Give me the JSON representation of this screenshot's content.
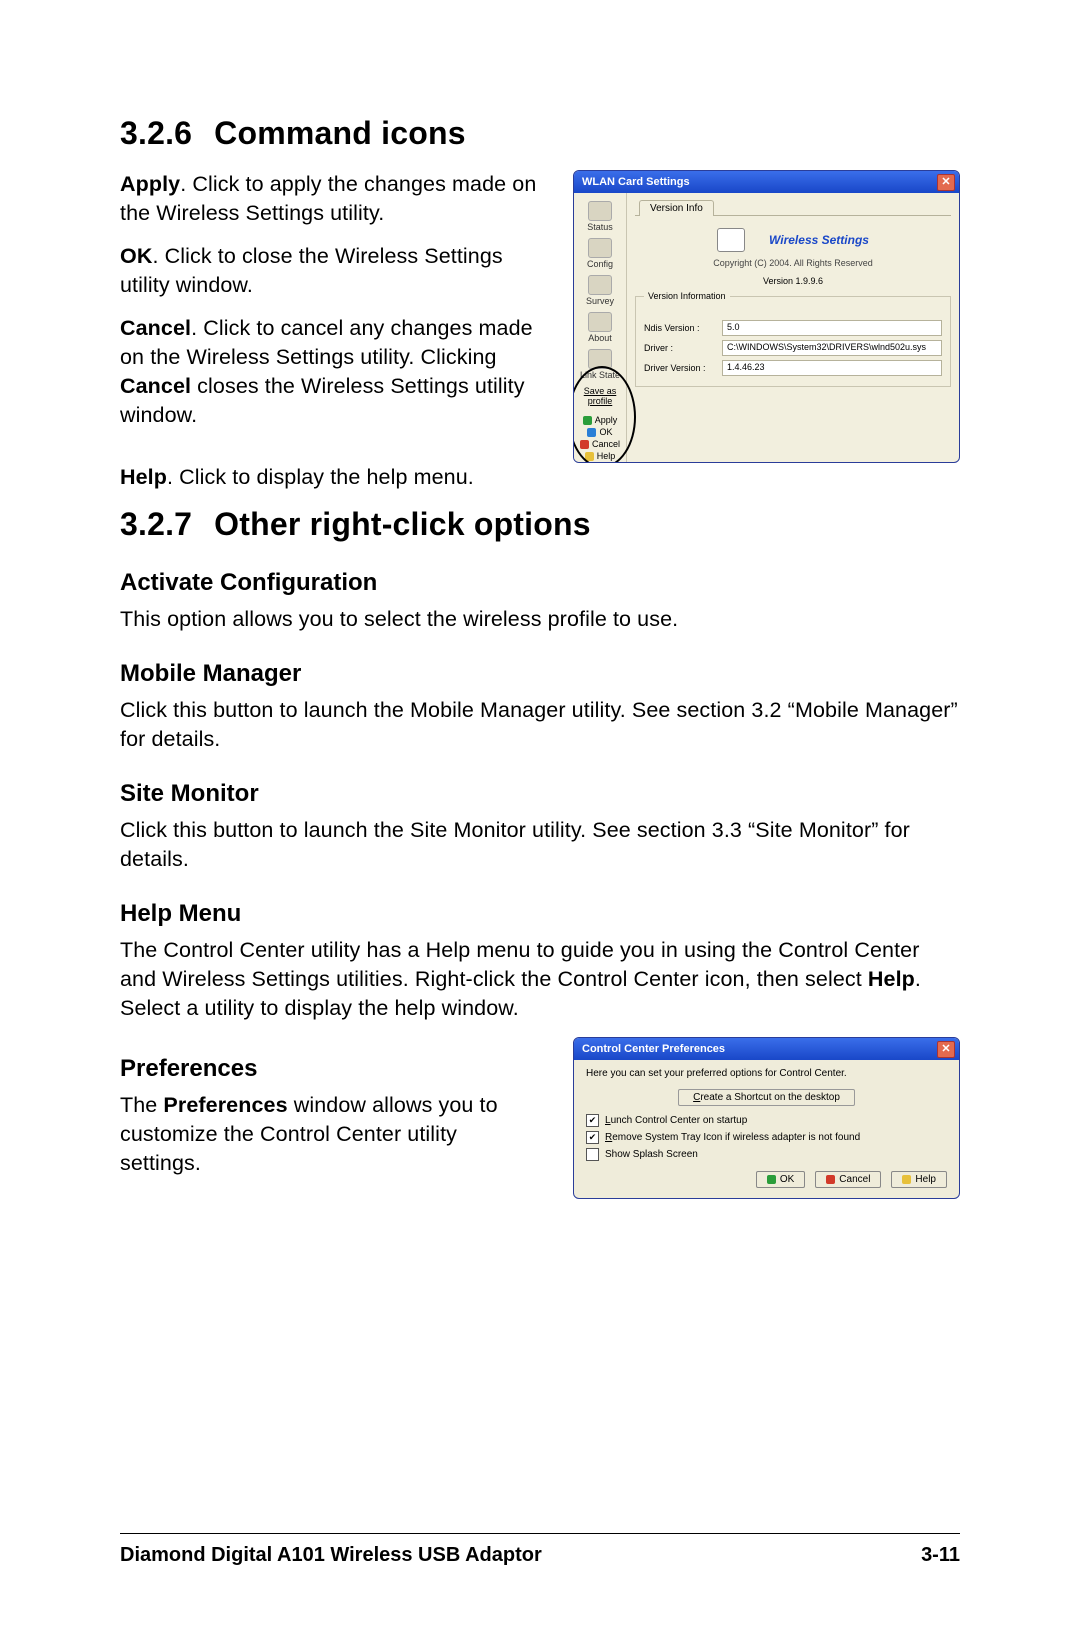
{
  "sections": {
    "s326": {
      "num": "3.2.6",
      "title": "Command icons"
    },
    "s327": {
      "num": "3.2.7",
      "title": "Other right-click options"
    }
  },
  "cmd": {
    "apply": {
      "label": "Apply",
      "text": ". Click to apply the changes made on the Wireless Settings utility."
    },
    "ok": {
      "label": "OK",
      "text": ". Click to close the Wireless Settings utility window."
    },
    "cancel_pre": ". Click to cancel any changes made on the Wireless Settings utility. Clicking ",
    "cancel_post": " closes the Wireless Settings utility window.",
    "cancel_label": "Cancel",
    "help": {
      "label": "Help",
      "text": ". Click to display the help menu."
    }
  },
  "sub": {
    "activate": {
      "title": "Activate Configuration",
      "text": "This option allows you to select the wireless profile to use."
    },
    "mobile": {
      "title": "Mobile Manager",
      "text": "Click this button to launch the Mobile Manager utility. See section 3.2 “Mobile Manager” for details."
    },
    "site": {
      "title": "Site Monitor",
      "text": "Click this button to launch the Site Monitor utility. See section 3.3 “Site Monitor” for details."
    },
    "helpmenu": {
      "title": "Help Menu",
      "pre": "The Control Center utility has a Help menu to guide you in using the Control Center and Wireless Settings utilities. Right-click the Control Center icon, then select ",
      "bold": "Help",
      "post": ". Select a utility to display the help window."
    },
    "prefs": {
      "title": "Preferences",
      "pre": "The ",
      "bold": "Preferences",
      "post": " window allows you to customize the Control Center utility settings."
    }
  },
  "wlan": {
    "title": "WLAN Card Settings",
    "tab": "Version Info",
    "brand": "Wireless Settings",
    "copyright": "Copyright (C) 2004. All Rights Reserved",
    "version": "Version 1.9.9.6",
    "fieldset": "Version Information",
    "ndis_k": "Ndis Version :",
    "ndis_v": "5.0",
    "drv_k": "Driver :",
    "drv_v": "C:\\WINDOWS\\System32\\DRIVERS\\wlnd502u.sys",
    "drvver_k": "Driver Version :",
    "drvver_v": "1.4.46.23",
    "side": {
      "status": "Status",
      "config": "Config",
      "survey": "Survey",
      "about": "About",
      "linkstate": "Link State"
    },
    "save": "Save as profile",
    "cmds": {
      "apply": "Apply",
      "ok": "OK",
      "cancel": "Cancel",
      "help": "Help"
    }
  },
  "pref": {
    "title": "Control Center Preferences",
    "msg": "Here you can set your preferred options for Control Center.",
    "shortcut": "Create a Shortcut on the desktop",
    "opt1": "Lunch Control Center on startup",
    "opt2": "Remove System Tray Icon if wireless adapter is not found",
    "opt3": "Show Splash Screen",
    "ok": "OK",
    "cancel": "Cancel",
    "help": "Help"
  },
  "footer": {
    "product": "Diamond Digital A101 Wireless USB Adaptor",
    "page": "3-11"
  }
}
